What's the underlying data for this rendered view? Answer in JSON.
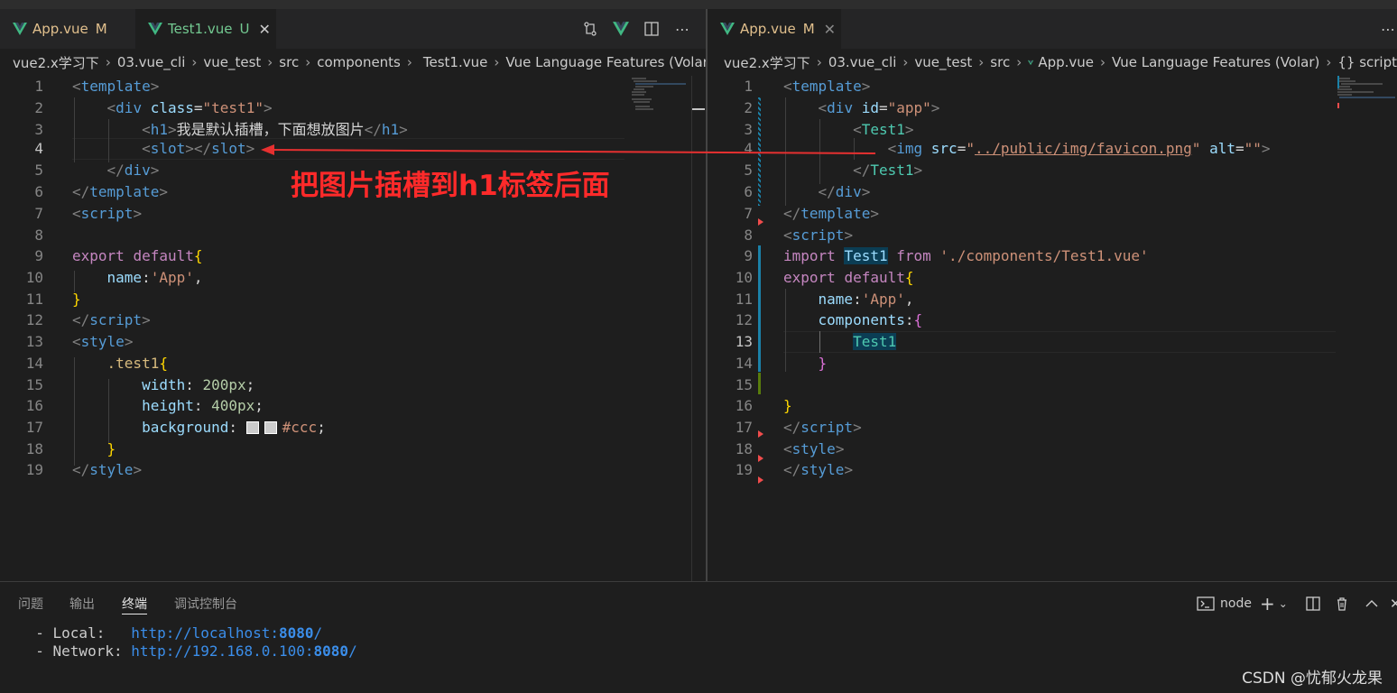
{
  "left_pane": {
    "tabs": [
      {
        "name": "App.vue",
        "mark": "M",
        "active": false
      },
      {
        "name": "Test1.vue",
        "mark": "U",
        "active": true
      }
    ],
    "breadcrumb": [
      "vue2.x学习下",
      "03.vue_cli",
      "vue_test",
      "src",
      "components",
      "Test1.vue",
      "Vue Language Features (Volar)"
    ],
    "line_numbers": [
      "1",
      "2",
      "3",
      "4",
      "5",
      "6",
      "7",
      "8",
      "9",
      "10",
      "11",
      "12",
      "13",
      "14",
      "15",
      "16",
      "17",
      "18",
      "19"
    ],
    "current_line": "4",
    "code": {
      "l1": [
        "<",
        "template",
        ">"
      ],
      "l2": [
        "<",
        "div",
        "class",
        "=",
        "\"test1\"",
        ">"
      ],
      "l3": [
        "<",
        "h1",
        ">",
        "我是默认插槽，下面想放图片",
        "</",
        "h1",
        ">"
      ],
      "l4": [
        "<",
        "slot",
        "></",
        "slot",
        ">"
      ],
      "l5": [
        "</",
        "div",
        ">"
      ],
      "l6": [
        "</",
        "template",
        ">"
      ],
      "l7": [
        "<",
        "script",
        ">"
      ],
      "l9": [
        "export",
        "default",
        "{"
      ],
      "l10": [
        "name",
        ":",
        "'App'",
        ","
      ],
      "l11": [
        "}"
      ],
      "l12": [
        "</",
        "script",
        ">"
      ],
      "l13": [
        "<",
        "style",
        ">"
      ],
      "l14": [
        ".test1",
        "{"
      ],
      "l15": [
        "width",
        ": ",
        "200px",
        ";"
      ],
      "l16": [
        "height",
        ": ",
        "400px",
        ";"
      ],
      "l17": [
        "background",
        ": ",
        "#ccc",
        ";"
      ],
      "l18": [
        "}"
      ],
      "l19": [
        "</",
        "style",
        ">"
      ]
    }
  },
  "right_pane": {
    "tabs": [
      {
        "name": "App.vue",
        "mark": "M",
        "active": true
      }
    ],
    "breadcrumb": [
      "vue2.x学习下",
      "03.vue_cli",
      "vue_test",
      "src",
      "App.vue",
      "Vue Language Features (Volar)",
      "{} script"
    ],
    "line_numbers": [
      "1",
      "2",
      "3",
      "4",
      "5",
      "6",
      "7",
      "8",
      "9",
      "10",
      "11",
      "12",
      "13",
      "14",
      "15",
      "16",
      "17",
      "18",
      "19"
    ],
    "current_line": "13",
    "code": {
      "l1": [
        "<",
        "template",
        ">"
      ],
      "l2": [
        "<",
        "div",
        "id",
        "=",
        "\"app\"",
        ">"
      ],
      "l3": [
        "<",
        "Test1",
        ">"
      ],
      "l4": [
        "<",
        "img",
        "src",
        "=",
        "\"",
        "../public/img/favicon.png",
        "\"",
        "alt",
        "=",
        "\"\"",
        ">"
      ],
      "l5": [
        "</",
        "Test1",
        ">"
      ],
      "l6": [
        "</",
        "div",
        ">"
      ],
      "l7": [
        "</",
        "template",
        ">"
      ],
      "l8": [
        "<",
        "script",
        ">"
      ],
      "l9": [
        "import",
        "Test1",
        "from",
        "'./components/Test1.vue'"
      ],
      "l10": [
        "export",
        "default",
        "{"
      ],
      "l11": [
        "name",
        ":",
        "'App'",
        ","
      ],
      "l12": [
        "components",
        ":",
        "{"
      ],
      "l13": [
        "Test1"
      ],
      "l14": [
        "}"
      ],
      "l16": [
        "}"
      ],
      "l17": [
        "</",
        "script",
        ">"
      ],
      "l18": [
        "<",
        "style",
        ">"
      ],
      "l19": [
        "</",
        "style",
        ">"
      ]
    }
  },
  "annotation": {
    "text": "把图片插槽到h1标签后面",
    "color": "#ff2a2a"
  },
  "panel": {
    "tabs": [
      "问题",
      "输出",
      "终端",
      "调试控制台"
    ],
    "active_tab": "终端",
    "terminal_name": "node",
    "terminal_lines": [
      {
        "label": "  - Local:   ",
        "url": "http://localhost:",
        "port": "8080",
        "tail": "/"
      },
      {
        "label": "  - Network: ",
        "url": "http://192.168.0.100:",
        "port": "8080",
        "tail": "/"
      }
    ]
  },
  "watermark": "CSDN @忧郁火龙果",
  "colors": {
    "modified": "#e2c08d",
    "untracked": "#73c991",
    "keyword": "#c586c0",
    "tag": "#569cd6",
    "string": "#ce9178"
  }
}
